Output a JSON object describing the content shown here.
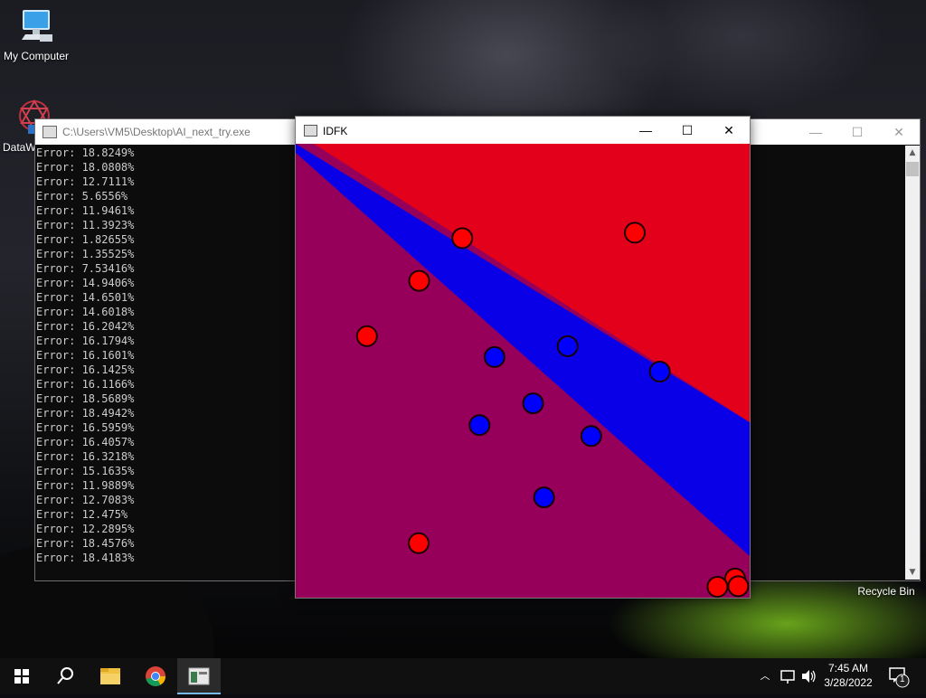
{
  "desktop": {
    "icons": [
      {
        "label": "My Computer",
        "icon": "computer-icon"
      },
      {
        "label": "DataW",
        "icon": "datawrangler-icon"
      },
      {
        "label": "Recycle Bin",
        "icon": "recycle-bin-icon"
      }
    ]
  },
  "console_window": {
    "title": "C:\\Users\\VM5\\Desktop\\AI_next_try.exe",
    "minimize": "—",
    "maximize": "☐",
    "close": "✕",
    "lines": [
      "Error: 18.8249%",
      "Error: 18.0808%",
      "Error: 12.7111%",
      "Error: 5.6556%",
      "Error: 11.9461%",
      "Error: 11.3923%",
      "Error: 1.82655%",
      "Error: 1.35525%",
      "Error: 7.53416%",
      "Error: 14.9406%",
      "Error: 14.6501%",
      "Error: 14.6018%",
      "Error: 16.2042%",
      "Error: 16.1794%",
      "Error: 16.1601%",
      "Error: 16.1425%",
      "Error: 16.1166%",
      "Error: 18.5689%",
      "Error: 18.4942%",
      "Error: 16.5959%",
      "Error: 16.4057%",
      "Error: 16.3218%",
      "Error: 15.1635%",
      "Error: 11.9889%",
      "Error: 12.7083%",
      "Error: 12.475%",
      "Error: 12.2895%",
      "Error: 18.4576%",
      "Error: 18.4183%"
    ]
  },
  "idfk_window": {
    "title": "IDFK",
    "minimize": "—",
    "maximize": "☐",
    "close": "✕",
    "colors": {
      "red": "#e2001a",
      "blue": "#0a00e8",
      "purple": "#96005a"
    },
    "points": [
      {
        "cls": "red",
        "u": 0.367,
        "v": 0.208
      },
      {
        "cls": "red",
        "u": 0.747,
        "v": 0.196
      },
      {
        "cls": "red",
        "u": 0.272,
        "v": 0.302
      },
      {
        "cls": "red",
        "u": 0.157,
        "v": 0.424
      },
      {
        "cls": "blue",
        "u": 0.599,
        "v": 0.446
      },
      {
        "cls": "blue",
        "u": 0.438,
        "v": 0.47
      },
      {
        "cls": "blue",
        "u": 0.802,
        "v": 0.502
      },
      {
        "cls": "blue",
        "u": 0.523,
        "v": 0.572
      },
      {
        "cls": "blue",
        "u": 0.405,
        "v": 0.62
      },
      {
        "cls": "blue",
        "u": 0.651,
        "v": 0.644
      },
      {
        "cls": "blue",
        "u": 0.547,
        "v": 0.779
      },
      {
        "cls": "red",
        "u": 0.271,
        "v": 0.88
      },
      {
        "cls": "red",
        "u": 0.968,
        "v": 0.958
      },
      {
        "cls": "red",
        "u": 0.975,
        "v": 0.975
      },
      {
        "cls": "red",
        "u": 0.929,
        "v": 0.976
      }
    ]
  },
  "taskbar": {
    "start": "windows-start-icon",
    "apps": [
      "search-icon",
      "file-explorer-icon",
      "chrome-icon",
      "console-app-icon"
    ],
    "time": "7:45 AM",
    "date": "3/28/2022",
    "notifications_count": "1"
  }
}
